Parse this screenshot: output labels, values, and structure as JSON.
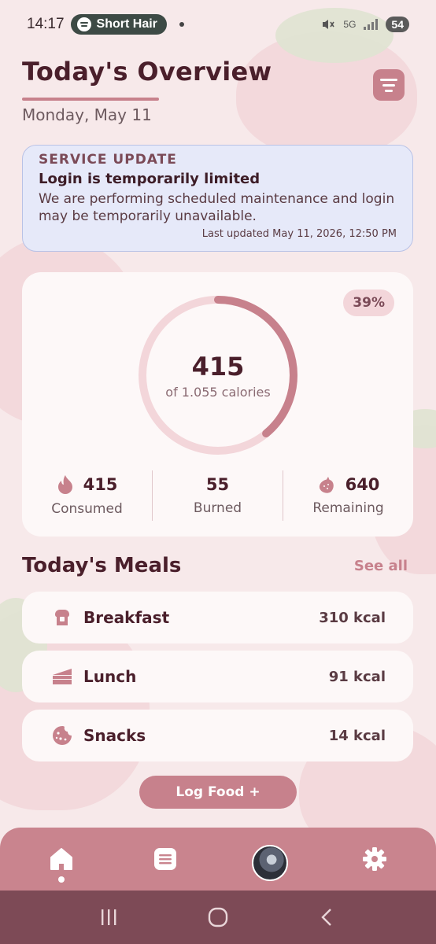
{
  "status_bar": {
    "time": "14:17",
    "media_title": "Short Hair",
    "network": "5G",
    "battery": "54"
  },
  "header": {
    "title": "Today's Overview",
    "date": "Monday, May 11"
  },
  "service_update": {
    "heading": "SERVICE UPDATE",
    "title": "Login is temporarily limited",
    "body": "We are performing scheduled maintenance and login may be temporarily unavailable.",
    "last_updated": "Last updated May 11, 2026, 12:50 PM"
  },
  "calories": {
    "percent_label": "39%",
    "progress": 0.39,
    "consumed_value": "415",
    "of_label": "of 1.055 calories",
    "stats": [
      {
        "value": "415",
        "label": "Consumed",
        "icon": "flame-icon"
      },
      {
        "value": "55",
        "label": "Burned"
      },
      {
        "value": "640",
        "label": "Remaining",
        "icon": "strawberry-icon"
      }
    ]
  },
  "meals": {
    "title": "Today's Meals",
    "see_all": "See all",
    "items": [
      {
        "name": "Breakfast",
        "kcal": "310 kcal",
        "icon": "toast-icon"
      },
      {
        "name": "Lunch",
        "kcal": "91 kcal",
        "icon": "cake-slice-icon"
      },
      {
        "name": "Snacks",
        "kcal": "14 kcal",
        "icon": "cookie-icon"
      }
    ]
  },
  "log_button": "Log Food +",
  "nav": {
    "items": [
      "home-icon",
      "list-icon",
      "avatar",
      "gear-icon"
    ],
    "active": "home-icon"
  },
  "colors": {
    "accent": "#c7818c",
    "background": "#f7e9ea",
    "text_dark": "#4a1f2b",
    "banner_bg": "#e6e9f9"
  }
}
